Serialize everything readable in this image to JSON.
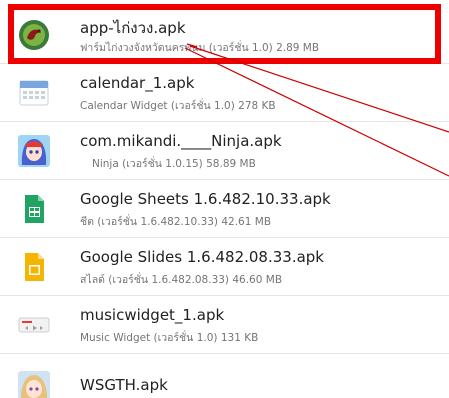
{
  "files": [
    {
      "name": "app-ไก่งวง.apk",
      "meta": "ฟาร์มไก่งวงจังหวัดนครพนม (เวอร์ชั่น 1.0) 2.89 MB",
      "icon": "app-logo-icon",
      "color": "#3a7a3a"
    },
    {
      "name": "calendar_1.apk",
      "meta": "Calendar Widget (เวอร์ชั่น 1.0) 278 KB",
      "icon": "calendar-icon",
      "color": "#d0d8e4"
    },
    {
      "name": "com.mikandi.____Ninja.apk",
      "meta": "Ninja (เวอร์ชั่น 1.0.15) 58.89 MB",
      "icon": "anime-character-icon",
      "color": "#5b6fd6"
    },
    {
      "name": "Google Sheets 1.6.482.10.33.apk",
      "meta": "ชีต (เวอร์ชั่น 1.6.482.10.33) 42.61 MB",
      "icon": "google-sheets-icon",
      "color": "#1fa463"
    },
    {
      "name": "Google Slides 1.6.482.08.33.apk",
      "meta": "สไลด์ (เวอร์ชั่น 1.6.482.08.33) 46.60 MB",
      "icon": "google-slides-icon",
      "color": "#f4b400"
    },
    {
      "name": "musicwidget_1.apk",
      "meta": "Music Widget (เวอร์ชั่น 1.0) 131 KB",
      "icon": "music-widget-icon",
      "color": "#e0e0e0"
    },
    {
      "name": "WSGTH.apk",
      "meta": "",
      "icon": "anime-girl-icon",
      "color": "#c9a0c9"
    }
  ],
  "colors": {
    "highlight": "#ee0000",
    "arrow": "#cc0000"
  }
}
